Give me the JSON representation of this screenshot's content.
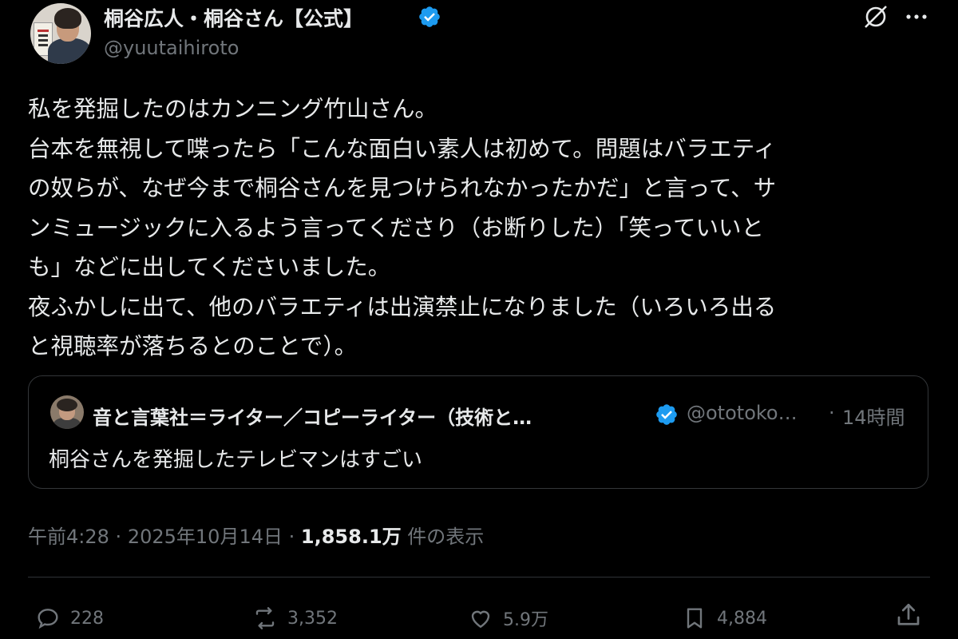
{
  "author": {
    "display_name": "桐谷広人・桐谷さん【公式】",
    "handle": "@yuutaihiroto",
    "verified": true
  },
  "tweet": {
    "lines": [
      "私を発掘したのはカンニング竹山さん。",
      "台本を無視して喋ったら「こんな面白い素人は初めて。問題はバラエティ",
      "の奴らが、なぜ今まで桐谷さんを見つけられなかったかだ」と言って、サ",
      "ンミュージックに入るよう言ってくださり（お断りした）「笑っていいと",
      "も」などに出してくださいました。",
      "夜ふかしに出て、他のバラエティは出演禁止になりました（いろいろ出る",
      "と視聴率が落ちるとのことで）。"
    ]
  },
  "quote": {
    "display_name": "音と言葉社＝ライター／コピーライター（技術と…",
    "handle": "@ototoko…",
    "separator": "·",
    "time": "14時間",
    "text": "桐谷さんを発掘したテレビマンはすごい",
    "verified": true
  },
  "meta": {
    "time": "午前4:28",
    "sep1": "·",
    "date": "2025年10月14日",
    "sep2": "·",
    "views_count": "1,858.1万",
    "views_label": "件の表示"
  },
  "actions": {
    "replies": "228",
    "reposts": "3,352",
    "likes": "5.9万",
    "bookmarks": "4,884"
  },
  "colors": {
    "background": "#000000",
    "text": "#e7e9ea",
    "secondary": "#71767b",
    "verified": "#1d9bf0",
    "border": "#333639"
  },
  "icons": [
    "verified-badge-icon",
    "grok-icon",
    "more-icon",
    "reply-icon",
    "repost-icon",
    "like-icon",
    "bookmark-icon",
    "share-icon"
  ]
}
